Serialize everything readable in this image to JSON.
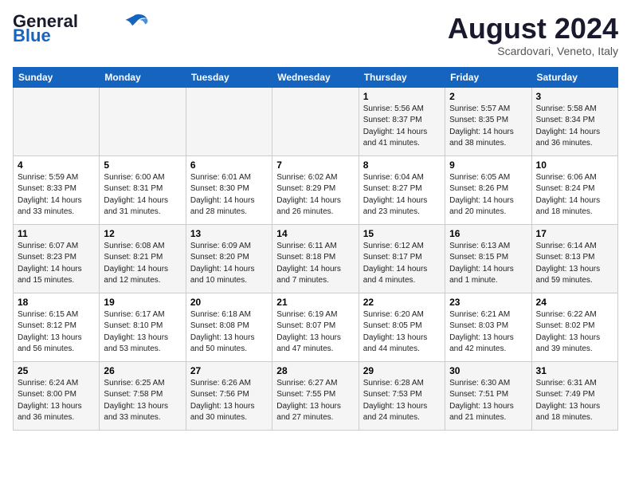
{
  "header": {
    "logo_line1": "General",
    "logo_line2": "Blue",
    "month_year": "August 2024",
    "location": "Scardovari, Veneto, Italy"
  },
  "days_of_week": [
    "Sunday",
    "Monday",
    "Tuesday",
    "Wednesday",
    "Thursday",
    "Friday",
    "Saturday"
  ],
  "weeks": [
    [
      {
        "num": "",
        "info": ""
      },
      {
        "num": "",
        "info": ""
      },
      {
        "num": "",
        "info": ""
      },
      {
        "num": "",
        "info": ""
      },
      {
        "num": "1",
        "info": "Sunrise: 5:56 AM\nSunset: 8:37 PM\nDaylight: 14 hours\nand 41 minutes."
      },
      {
        "num": "2",
        "info": "Sunrise: 5:57 AM\nSunset: 8:35 PM\nDaylight: 14 hours\nand 38 minutes."
      },
      {
        "num": "3",
        "info": "Sunrise: 5:58 AM\nSunset: 8:34 PM\nDaylight: 14 hours\nand 36 minutes."
      }
    ],
    [
      {
        "num": "4",
        "info": "Sunrise: 5:59 AM\nSunset: 8:33 PM\nDaylight: 14 hours\nand 33 minutes."
      },
      {
        "num": "5",
        "info": "Sunrise: 6:00 AM\nSunset: 8:31 PM\nDaylight: 14 hours\nand 31 minutes."
      },
      {
        "num": "6",
        "info": "Sunrise: 6:01 AM\nSunset: 8:30 PM\nDaylight: 14 hours\nand 28 minutes."
      },
      {
        "num": "7",
        "info": "Sunrise: 6:02 AM\nSunset: 8:29 PM\nDaylight: 14 hours\nand 26 minutes."
      },
      {
        "num": "8",
        "info": "Sunrise: 6:04 AM\nSunset: 8:27 PM\nDaylight: 14 hours\nand 23 minutes."
      },
      {
        "num": "9",
        "info": "Sunrise: 6:05 AM\nSunset: 8:26 PM\nDaylight: 14 hours\nand 20 minutes."
      },
      {
        "num": "10",
        "info": "Sunrise: 6:06 AM\nSunset: 8:24 PM\nDaylight: 14 hours\nand 18 minutes."
      }
    ],
    [
      {
        "num": "11",
        "info": "Sunrise: 6:07 AM\nSunset: 8:23 PM\nDaylight: 14 hours\nand 15 minutes."
      },
      {
        "num": "12",
        "info": "Sunrise: 6:08 AM\nSunset: 8:21 PM\nDaylight: 14 hours\nand 12 minutes."
      },
      {
        "num": "13",
        "info": "Sunrise: 6:09 AM\nSunset: 8:20 PM\nDaylight: 14 hours\nand 10 minutes."
      },
      {
        "num": "14",
        "info": "Sunrise: 6:11 AM\nSunset: 8:18 PM\nDaylight: 14 hours\nand 7 minutes."
      },
      {
        "num": "15",
        "info": "Sunrise: 6:12 AM\nSunset: 8:17 PM\nDaylight: 14 hours\nand 4 minutes."
      },
      {
        "num": "16",
        "info": "Sunrise: 6:13 AM\nSunset: 8:15 PM\nDaylight: 14 hours\nand 1 minute."
      },
      {
        "num": "17",
        "info": "Sunrise: 6:14 AM\nSunset: 8:13 PM\nDaylight: 13 hours\nand 59 minutes."
      }
    ],
    [
      {
        "num": "18",
        "info": "Sunrise: 6:15 AM\nSunset: 8:12 PM\nDaylight: 13 hours\nand 56 minutes."
      },
      {
        "num": "19",
        "info": "Sunrise: 6:17 AM\nSunset: 8:10 PM\nDaylight: 13 hours\nand 53 minutes."
      },
      {
        "num": "20",
        "info": "Sunrise: 6:18 AM\nSunset: 8:08 PM\nDaylight: 13 hours\nand 50 minutes."
      },
      {
        "num": "21",
        "info": "Sunrise: 6:19 AM\nSunset: 8:07 PM\nDaylight: 13 hours\nand 47 minutes."
      },
      {
        "num": "22",
        "info": "Sunrise: 6:20 AM\nSunset: 8:05 PM\nDaylight: 13 hours\nand 44 minutes."
      },
      {
        "num": "23",
        "info": "Sunrise: 6:21 AM\nSunset: 8:03 PM\nDaylight: 13 hours\nand 42 minutes."
      },
      {
        "num": "24",
        "info": "Sunrise: 6:22 AM\nSunset: 8:02 PM\nDaylight: 13 hours\nand 39 minutes."
      }
    ],
    [
      {
        "num": "25",
        "info": "Sunrise: 6:24 AM\nSunset: 8:00 PM\nDaylight: 13 hours\nand 36 minutes."
      },
      {
        "num": "26",
        "info": "Sunrise: 6:25 AM\nSunset: 7:58 PM\nDaylight: 13 hours\nand 33 minutes."
      },
      {
        "num": "27",
        "info": "Sunrise: 6:26 AM\nSunset: 7:56 PM\nDaylight: 13 hours\nand 30 minutes."
      },
      {
        "num": "28",
        "info": "Sunrise: 6:27 AM\nSunset: 7:55 PM\nDaylight: 13 hours\nand 27 minutes."
      },
      {
        "num": "29",
        "info": "Sunrise: 6:28 AM\nSunset: 7:53 PM\nDaylight: 13 hours\nand 24 minutes."
      },
      {
        "num": "30",
        "info": "Sunrise: 6:30 AM\nSunset: 7:51 PM\nDaylight: 13 hours\nand 21 minutes."
      },
      {
        "num": "31",
        "info": "Sunrise: 6:31 AM\nSunset: 7:49 PM\nDaylight: 13 hours\nand 18 minutes."
      }
    ]
  ]
}
